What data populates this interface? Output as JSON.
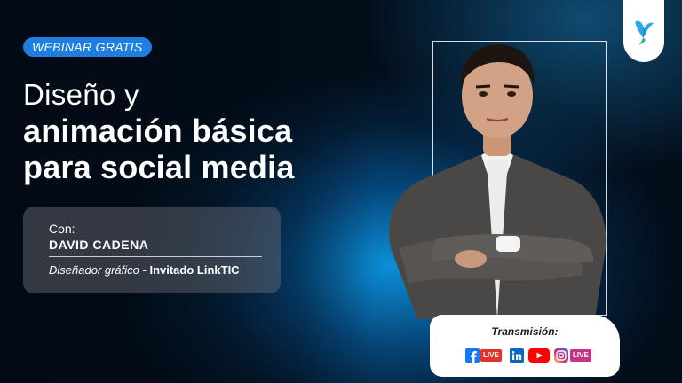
{
  "badge": {
    "text": "WEBINAR GRATIS"
  },
  "title": {
    "line1": "Diseño y",
    "line2": "animación básica",
    "line3": "para social media"
  },
  "host": {
    "con_label": "Con:",
    "name": "DAVID CADENA",
    "role": "Diseñador gráfico",
    "separator": " - ",
    "affiliation": "Invitado LinkTIC"
  },
  "stream": {
    "label": "Transmisión:",
    "facebook_live": "LIVE",
    "instagram_live": "LIVE"
  },
  "icons": {
    "logo": "bird-logo-icon",
    "facebook": "facebook-icon",
    "linkedin": "linkedin-icon",
    "youtube": "youtube-icon",
    "instagram": "instagram-icon"
  },
  "colors": {
    "accent_blue": "#1e7fe0",
    "facebook": "#1877f2",
    "linkedin": "#0a66c2",
    "youtube": "#ff0000",
    "instagram": "#c13584"
  }
}
